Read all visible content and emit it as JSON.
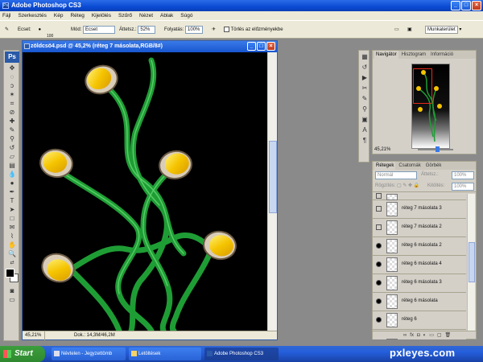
{
  "app": {
    "title": "Adobe Photoshop CS3",
    "icon": "ps-app-icon"
  },
  "window_controls": [
    "minimize-icon",
    "maximize-icon",
    "close-icon"
  ],
  "menu": [
    "Fájl",
    "Szerkesztés",
    "Kép",
    "Réteg",
    "Kijelölés",
    "Szűrő",
    "Nézet",
    "Ablak",
    "Súgó"
  ],
  "options": {
    "brush_label": "Ecset:",
    "brush_size": "100",
    "mode_label": "Mód:",
    "mode_value": "Ecset",
    "opacity_label": "Áttetsz.:",
    "opacity_value": "52%",
    "flow_label": "Folyatás:",
    "flow_value": "100%",
    "erase_history": "Törlés az előzményekbe",
    "workspace": "Munkaterület"
  },
  "document": {
    "title": "zöldcsö4.psd @ 45,2% (réteg 7 másolata,RGB/8#)",
    "zoom": "45,21%",
    "doc_info": "Dok.: 14,3M/46,2M"
  },
  "navigator": {
    "tabs": [
      "Navigátor",
      "Hisztogram",
      "Információ"
    ],
    "zoom": "45,21%"
  },
  "layers": {
    "tabs": [
      "Rétegek",
      "Csatornák",
      "Görbék"
    ],
    "blend_mode": "Normál",
    "opacity_label": "Áttetsz.:",
    "opacity_value": "100%",
    "lock_label": "Rögzítés:",
    "fill_label": "Kitöltés:",
    "fill_value": "100%",
    "items": [
      {
        "name": "",
        "visible": false
      },
      {
        "name": "réteg 7 másolata 3",
        "visible": false
      },
      {
        "name": "réteg 7 másolata 2",
        "visible": false
      },
      {
        "name": "réteg 6 másolata 2",
        "visible": true
      },
      {
        "name": "réteg 6 másolata 4",
        "visible": true
      },
      {
        "name": "réteg 6 másolata 3",
        "visible": true
      },
      {
        "name": "réteg 6 másolata",
        "visible": true
      },
      {
        "name": "réteg 6",
        "visible": true
      },
      {
        "name": "",
        "visible": true
      }
    ]
  },
  "taskbar": {
    "start": "Start",
    "items": [
      "Névtelen - Jegyzettömb",
      "Letöltések",
      "Adobe Photoshop CS3"
    ],
    "watermark": "pxleyes.com"
  },
  "colors": {
    "accent": "#245edb",
    "canvas_bg": "#000000",
    "pipe": "#23a13a",
    "cap": "#f5c400"
  }
}
